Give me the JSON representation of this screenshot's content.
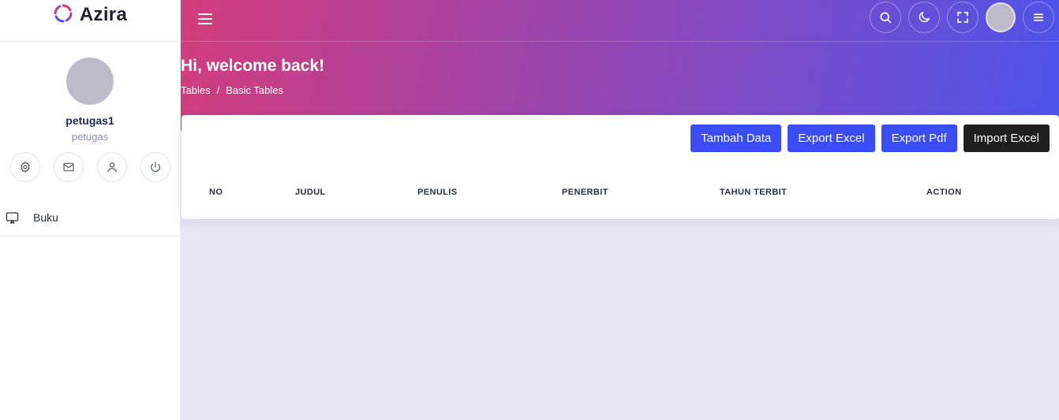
{
  "brand": {
    "name": "Azira"
  },
  "user": {
    "name": "petugas1",
    "role": "petugas"
  },
  "sidebar": {
    "menu": [
      {
        "label": "Buku",
        "icon": "monitor-icon"
      }
    ]
  },
  "header": {
    "welcome": "Hi, welcome back!",
    "breadcrumb": [
      "Tables",
      "/",
      "Basic Tables"
    ]
  },
  "toolbar": {
    "tambah_label": "Tambah Data",
    "export_excel_label": "Export Excel",
    "export_pdf_label": "Export Pdf",
    "import_excel_label": "Import Excel"
  },
  "table": {
    "columns": [
      "NO",
      "JUDUL",
      "PENULIS",
      "PENERBIT",
      "TAHUN TERBIT",
      "ACTION"
    ],
    "rows": []
  },
  "colors": {
    "primary": "#3a4cf5",
    "dark": "#1e1e1e",
    "gradient_start": "#d33d7c",
    "gradient_end": "#4d53e9"
  }
}
